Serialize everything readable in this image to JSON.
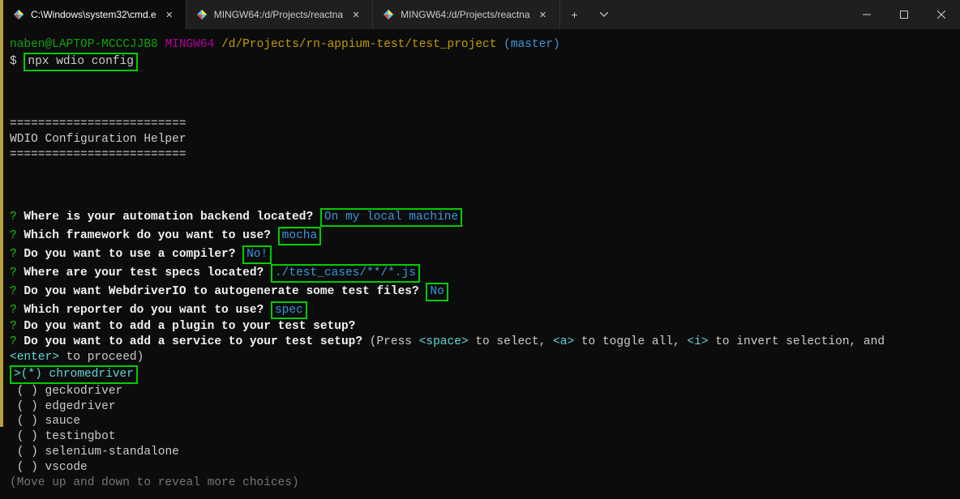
{
  "tabs": [
    {
      "label": "C:\\Windows\\system32\\cmd.e",
      "active": true
    },
    {
      "label": "MINGW64:/d/Projects/reactna",
      "active": false
    },
    {
      "label": "MINGW64:/d/Projects/reactna",
      "active": false
    }
  ],
  "prompt": {
    "user_host": "naben@LAPTOP-MCCCJJB8",
    "shell": "MINGW64",
    "path": "/d/Projects/rn-appium-test/test_project",
    "branch": "(master)",
    "symbol": "$",
    "command": "npx wdio config"
  },
  "divider": "=========================",
  "helper_title": "WDIO Configuration Helper",
  "qa": [
    {
      "q": "Where is your automation backend located?",
      "a": "On my local machine",
      "boxed": true
    },
    {
      "q": "Which framework do you want to use?",
      "a": "mocha",
      "boxed": true
    },
    {
      "q": "Do you want to use a compiler?",
      "a": "No!",
      "boxed": true
    },
    {
      "q": "Where are your test specs located?",
      "a": "./test_cases/**/*.js",
      "boxed": true
    },
    {
      "q": "Do you want WebdriverIO to autogenerate some test files?",
      "a": "No",
      "boxed": true
    },
    {
      "q": "Which reporter do you want to use?",
      "a": "spec",
      "boxed": true
    }
  ],
  "plugin_q": "Do you want to add a plugin to your test setup?",
  "service_q": "Do you want to add a service to your test setup?",
  "service_hint_pre": "(Press ",
  "service_hint_space": "<space>",
  "service_hint_mid1": " to select, ",
  "service_hint_a": "<a>",
  "service_hint_mid2": " to toggle all, ",
  "service_hint_i": "<i>",
  "service_hint_mid3": " to invert selection, and ",
  "service_hint_enter": "<enter>",
  "service_hint_end": " to proceed)",
  "options": [
    {
      "marker": ">(*)",
      "label": "chromedriver",
      "selected": true
    },
    {
      "marker": " ( )",
      "label": "geckodriver",
      "selected": false
    },
    {
      "marker": " ( )",
      "label": "edgedriver",
      "selected": false
    },
    {
      "marker": " ( )",
      "label": "sauce",
      "selected": false
    },
    {
      "marker": " ( )",
      "label": "testingbot",
      "selected": false
    },
    {
      "marker": " ( )",
      "label": "selenium-standalone",
      "selected": false
    },
    {
      "marker": " ( )",
      "label": "vscode",
      "selected": false
    }
  ],
  "more_hint": "(Move up and down to reveal more choices)"
}
